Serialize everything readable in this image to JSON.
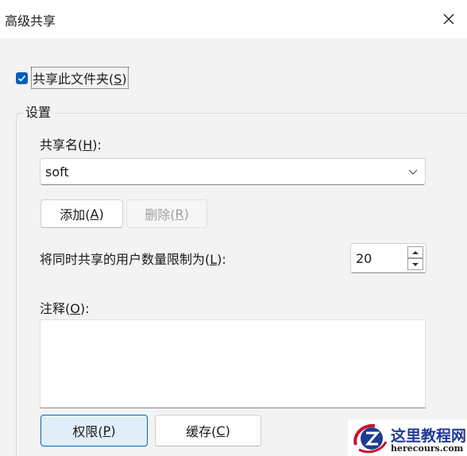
{
  "window": {
    "title": "高级共享"
  },
  "share_checkbox": {
    "label_main": "共享此文件夹(",
    "label_key": "S",
    "label_end": ")",
    "checked": true
  },
  "settings": {
    "group_title": "设置",
    "share_name_label_main": "共享名(",
    "share_name_label_key": "H",
    "share_name_label_end": "):",
    "share_name_value": "soft",
    "add_button_main": "添加(",
    "add_button_key": "A",
    "add_button_end": ")",
    "remove_button_main": "删除(",
    "remove_button_key": "R",
    "remove_button_end": ")",
    "user_limit_label_main": "将同时共享的用户数量限制为(",
    "user_limit_label_key": "L",
    "user_limit_label_end": "):",
    "user_limit_value": "20",
    "comment_label_main": "注释(",
    "comment_label_key": "O",
    "comment_label_end": "):",
    "comment_value": ""
  },
  "buttons": {
    "permissions_main": "权限(",
    "permissions_key": "P",
    "permissions_end": ")",
    "caching_main": "缓存(",
    "caching_key": "C",
    "caching_end": ")"
  },
  "watermark": {
    "text": "这里教程网",
    "url": "herecours.com"
  },
  "colors": {
    "accent": "#005fb8",
    "focus_border": "#0067c0",
    "focus_fill": "#e0eef9"
  },
  "icons": {
    "close": "close-icon",
    "check": "checkmark-icon",
    "dropdown": "chevron-down-icon",
    "spin_up": "caret-up-icon",
    "spin_down": "caret-down-icon"
  }
}
